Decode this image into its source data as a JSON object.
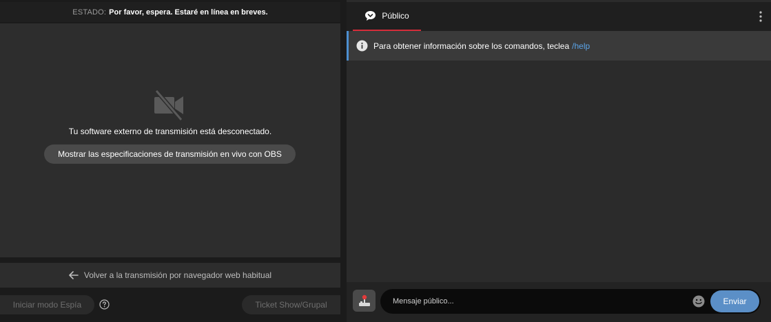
{
  "status": {
    "label": "ESTADO:",
    "text": "Por favor, espera. Estaré en línea en breves."
  },
  "video": {
    "icon": "video-off-icon",
    "message": "Tu software externo de transmisión está desconectado.",
    "obs_button": "Mostrar las especificaciones de transmisión en vivo con OBS"
  },
  "back_bar": {
    "icon": "arrow-left-icon",
    "label": "Volver a la transmisión por navegador web habitual"
  },
  "controls": {
    "spy_button": "Iniciar modo Espía",
    "help_icon": "question-circle-icon",
    "ticket_button": "Ticket Show/Grupal"
  },
  "chat": {
    "tab_label": "Público",
    "tab_icon": "chat-bubble-icon",
    "menu_icon": "kebab-menu-icon",
    "info": {
      "icon": "info-icon",
      "text": "Para obtener información sobre los comandos, teclea",
      "command": "/help"
    },
    "input": {
      "placeholder": "Mensaje público...",
      "value": "",
      "joystick_icon": "joystick-icon",
      "emoji_icon": "emoji-icon",
      "send_label": "Enviar"
    }
  },
  "colors": {
    "accent_tab": "#d62c3a",
    "info_border": "#4d8fd1",
    "link": "#5ba4e8",
    "send_button": "#5b8fc7"
  }
}
